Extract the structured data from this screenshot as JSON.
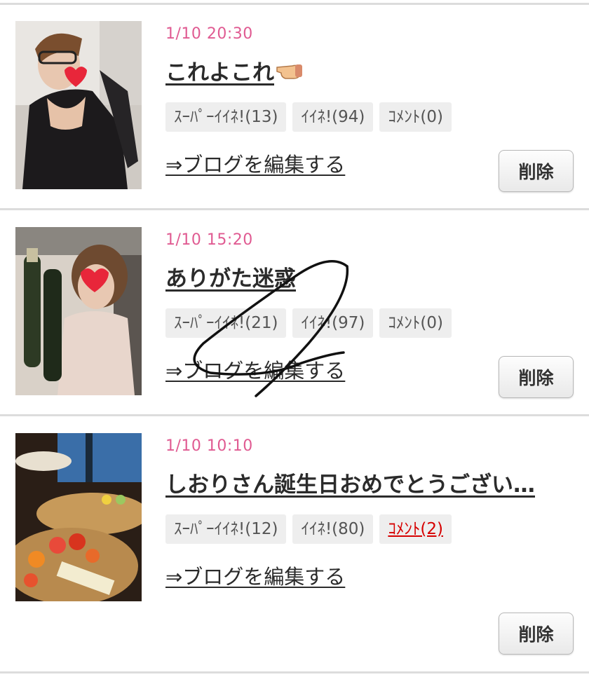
{
  "posts": [
    {
      "date": "1/10 20:30",
      "title": "これよこれ",
      "title_icon": "pointing-hand-icon",
      "badges": {
        "super_like": "ｽｰﾊﾟｰｲｲﾈ!(13)",
        "like": "ｲｲﾈ!(94)",
        "comment": "ｺﾒﾝﾄ(0)"
      },
      "edit_label": "⇒ブログを編集する",
      "delete_label": "削除",
      "comment_alert": false
    },
    {
      "date": "1/10 15:20",
      "title": "ありがた迷惑",
      "badges": {
        "super_like": "ｽｰﾊﾟｰｲｲﾈ!(21)",
        "like": "ｲｲﾈ!(97)",
        "comment": "ｺﾒﾝﾄ(0)"
      },
      "edit_label": "⇒ブログを編集する",
      "delete_label": "削除",
      "comment_alert": false
    },
    {
      "date": "1/10 10:10",
      "title": "しおりさん誕生日おめでとうござい…",
      "badges": {
        "super_like": "ｽｰﾊﾟｰｲｲﾈ!(12)",
        "like": "ｲｲﾈ!(80)",
        "comment": "ｺﾒﾝﾄ(2)"
      },
      "edit_label": "⇒ブログを編集する",
      "delete_label": "削除",
      "comment_alert": true
    }
  ],
  "colors": {
    "date": "#e05b92",
    "alert": "#d60000",
    "badge_bg": "#eeeeee",
    "divider": "#dcdcdc"
  }
}
